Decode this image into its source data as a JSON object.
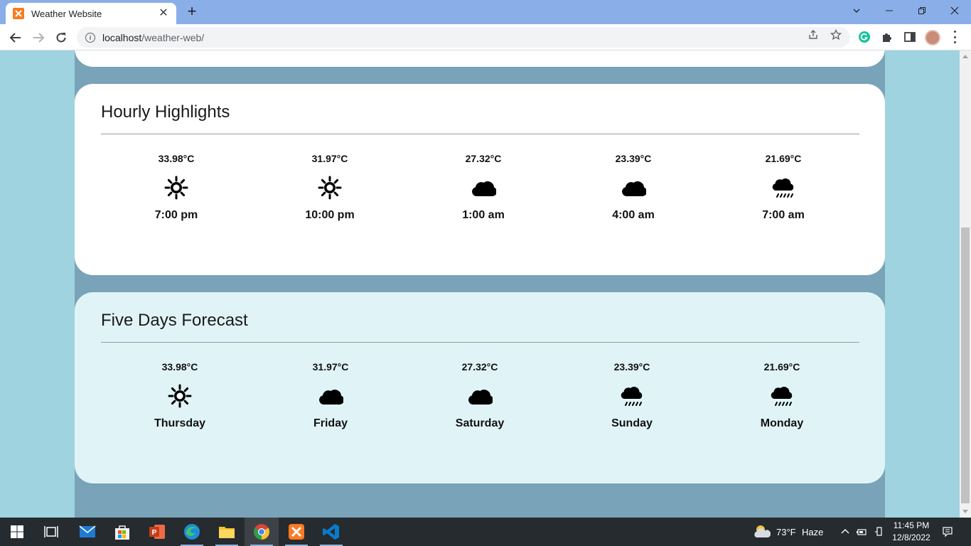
{
  "browser": {
    "tab_title": "Weather Website",
    "tab_close": "✕",
    "new_tab": "+",
    "url_host": "localhost",
    "url_path": "/weather-web/"
  },
  "hourly": {
    "title": "Hourly Highlights",
    "items": [
      {
        "temp": "33.98°C",
        "icon": "sun-icon",
        "label": "7:00 pm"
      },
      {
        "temp": "31.97°C",
        "icon": "sun-icon",
        "label": "10:00 pm"
      },
      {
        "temp": "27.32°C",
        "icon": "cloud-icon",
        "label": "1:00 am"
      },
      {
        "temp": "23.39°C",
        "icon": "cloud-icon",
        "label": "4:00 am"
      },
      {
        "temp": "21.69°C",
        "icon": "rain-cloud-icon",
        "label": "7:00 am"
      }
    ]
  },
  "five_days": {
    "title": "Five Days Forecast",
    "items": [
      {
        "temp": "33.98°C",
        "icon": "sun-icon",
        "label": "Thursday"
      },
      {
        "temp": "31.97°C",
        "icon": "cloud-icon",
        "label": "Friday"
      },
      {
        "temp": "27.32°C",
        "icon": "cloud-icon",
        "label": "Saturday"
      },
      {
        "temp": "23.39°C",
        "icon": "rain-cloud-icon",
        "label": "Sunday"
      },
      {
        "temp": "21.69°C",
        "icon": "rain-cloud-icon",
        "label": "Monday"
      }
    ]
  },
  "taskbar": {
    "weather_temp": "73°F",
    "weather_desc": "Haze",
    "time": "11:45 PM",
    "date": "12/8/2022"
  },
  "colors": {
    "page_background": "#9fd3df",
    "content_column": "#78a3b8",
    "hourly_card": "#ffffff",
    "forecast_card": "#e0f4f7",
    "tab_strip": "#8aaee8"
  }
}
